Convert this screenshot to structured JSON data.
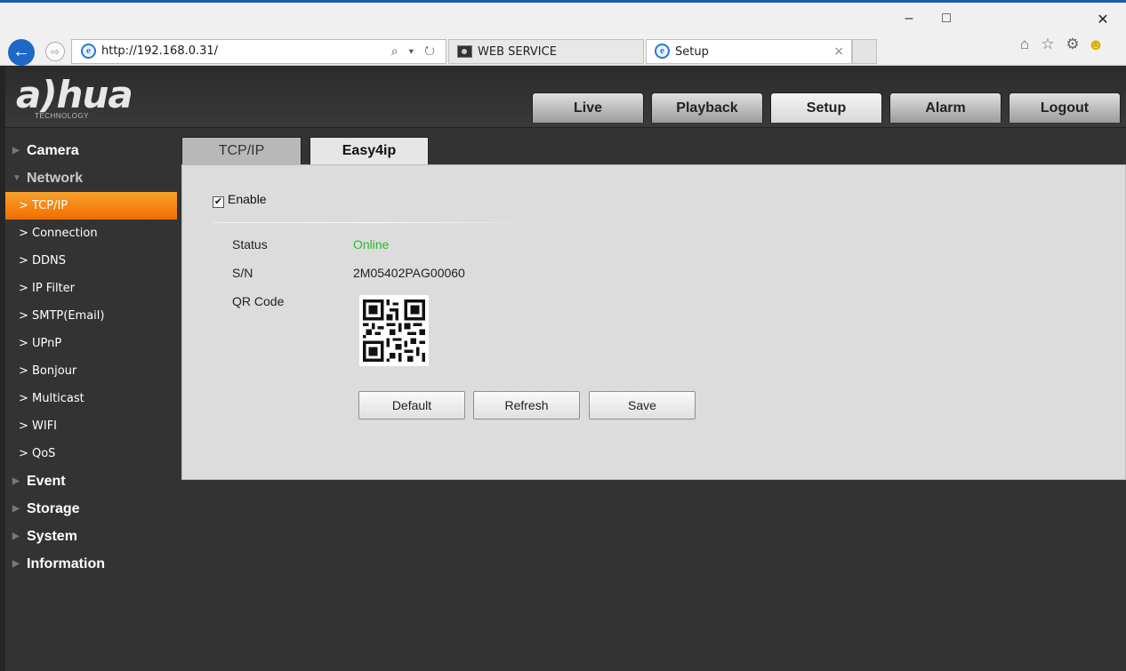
{
  "browser": {
    "url": "http://192.168.0.31/",
    "address_controls": "⌕ ▾ ↻",
    "tabs": [
      {
        "title": "WEB SERVICE"
      },
      {
        "title": "Setup",
        "close": "×"
      }
    ],
    "window_controls": {
      "minimize": "–",
      "maximize": "□",
      "close": "✕"
    },
    "tool_icons": [
      "home-icon",
      "star-icon",
      "gear-icon",
      "smiley-icon"
    ]
  },
  "app": {
    "logo": "a)hua",
    "logo_sub": "TECHNOLOGY",
    "main_tabs": [
      "Live",
      "Playback",
      "Setup",
      "Alarm",
      "Logout"
    ],
    "active_main_tab": "Setup",
    "sidebar": {
      "sections": [
        "Camera",
        "Network",
        "Event",
        "Storage",
        "System",
        "Information"
      ],
      "network_items": [
        "TCP/IP",
        "Connection",
        "DDNS",
        "IP Filter",
        "SMTP(Email)",
        "UPnP",
        "Bonjour",
        "Multicast",
        "WIFI",
        "QoS"
      ],
      "active_item": "TCP/IP"
    },
    "sub_tabs": [
      "TCP/IP",
      "Easy4ip"
    ],
    "active_sub_tab": "Easy4ip",
    "form": {
      "enable_label": "Enable",
      "enable_checked": true,
      "status_label": "Status",
      "status_value": "Online",
      "sn_label": "S/N",
      "sn_value": "2M05402PAG00060",
      "qr_label": "QR Code"
    },
    "buttons": {
      "default": "Default",
      "refresh": "Refresh",
      "save": "Save"
    }
  },
  "colors": {
    "accent_orange": "#f26d00",
    "status_online": "#2fb82f",
    "panel_bg": "#dcdcdc",
    "app_bg": "#333333"
  }
}
